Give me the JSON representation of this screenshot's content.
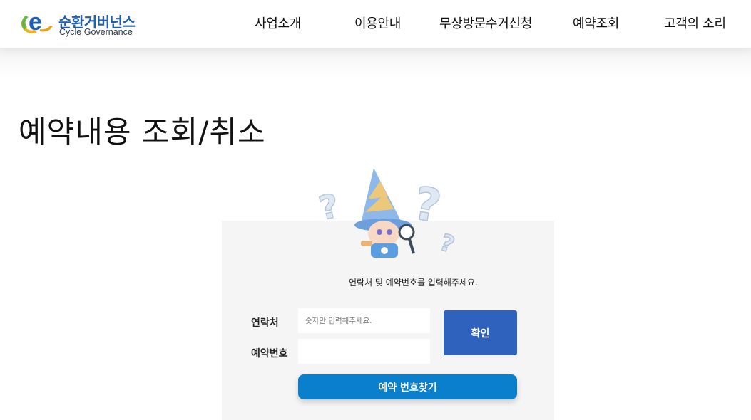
{
  "header": {
    "logo_title": "순환거버넌스",
    "logo_subtitle": "Cycle Governance",
    "nav": [
      {
        "label": "사업소개"
      },
      {
        "label": "이용안내"
      },
      {
        "label": "무상방문수거신청"
      },
      {
        "label": "예약조회"
      },
      {
        "label": "고객의 소리"
      }
    ]
  },
  "page": {
    "title": "예약내용 조회/취소"
  },
  "form": {
    "instruction": "연락처 및 예약번호를 입력해주세요.",
    "contact_label": "연락처",
    "contact_placeholder": "숫자만 입력해주세요.",
    "contact_value": "",
    "reservation_label": "예약번호",
    "reservation_value": "",
    "confirm_label": "확인",
    "find_label": "예약 번호찾기"
  },
  "colors": {
    "brand_blue": "#1e5fb4",
    "confirm_button": "#2f62bd",
    "find_button": "#0a7fcb",
    "panel_bg": "#f5f5f5"
  },
  "icons": [
    "logo-e-icon",
    "mascot-wizard-illustration",
    "question-mark-icon"
  ]
}
